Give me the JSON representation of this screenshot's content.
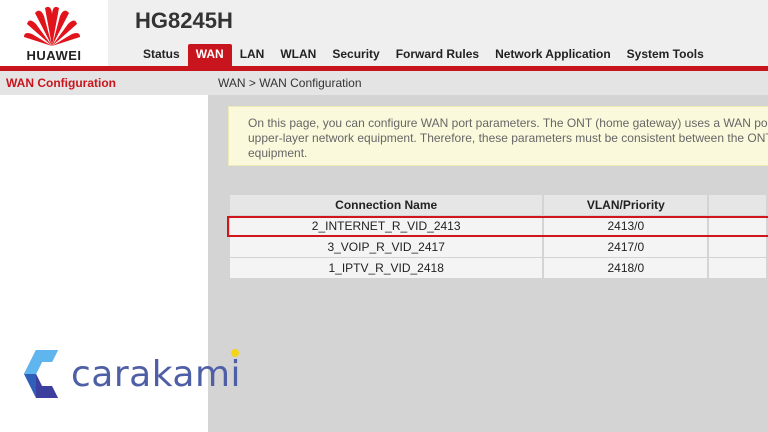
{
  "brand": {
    "logo_text": "HUAWEI",
    "model": "HG8245H"
  },
  "nav": {
    "items": [
      {
        "label": "Status",
        "active": false
      },
      {
        "label": "WAN",
        "active": true
      },
      {
        "label": "LAN",
        "active": false
      },
      {
        "label": "WLAN",
        "active": false
      },
      {
        "label": "Security",
        "active": false
      },
      {
        "label": "Forward Rules",
        "active": false
      },
      {
        "label": "Network Application",
        "active": false
      },
      {
        "label": "System Tools",
        "active": false
      }
    ]
  },
  "sidebar": {
    "title": "WAN Configuration"
  },
  "breadcrumb": "WAN > WAN Configuration",
  "notice": {
    "lines": [
      "On this page, you can configure WAN port parameters. The ONT (home gateway) uses a WAN port to",
      "upper-layer network equipment. Therefore, these parameters must be consistent between the ONT a",
      "equipment."
    ]
  },
  "table": {
    "headers": [
      "Connection Name",
      "VLAN/Priority",
      ""
    ],
    "rows": [
      {
        "name": "2_INTERNET_R_VID_2413",
        "vlan": "2413/0",
        "selected": true
      },
      {
        "name": "3_VOIP_R_VID_2417",
        "vlan": "2417/0",
        "selected": false
      },
      {
        "name": "1_IPTV_R_VID_2418",
        "vlan": "2418/0",
        "selected": false
      }
    ]
  },
  "watermark": {
    "text": "carakami"
  },
  "colors": {
    "accent": "#c8151d",
    "notice_bg": "#fbf9dc",
    "watermark": "#4e5fa6"
  }
}
